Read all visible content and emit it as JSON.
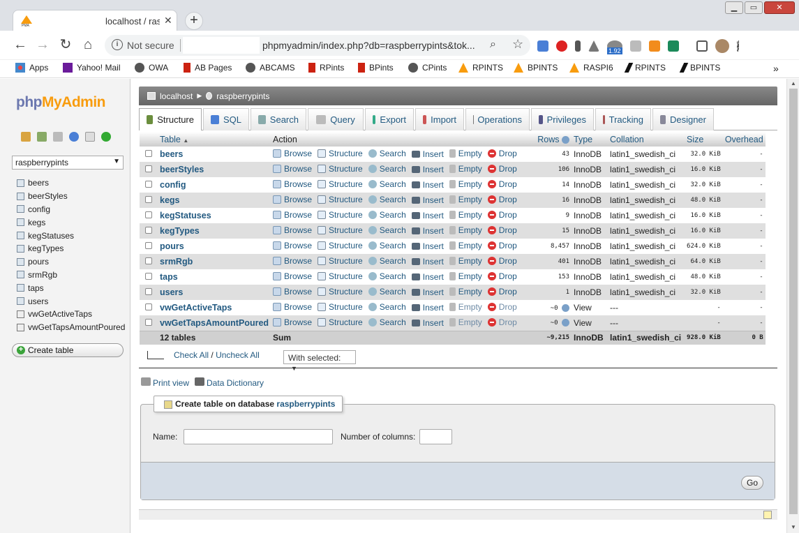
{
  "browser": {
    "tab_title": "localhost / ras",
    "tab_close": "✕",
    "new_tab": "+",
    "window_buttons": [
      "▁",
      "▭",
      "✕"
    ],
    "not_secure": "Not secure",
    "url": "phpmyadmin/index.php?db=raspberrypints&tok...",
    "extension_badge": "1.92",
    "bookmarks": [
      "Apps",
      "Yahoo! Mail",
      "OWA",
      "AB Pages",
      "ABCAMS",
      "RPints",
      "BPints",
      "CPints",
      "RPINTS",
      "BPINTS",
      "RASPI6",
      "RPINTS",
      "BPINTS"
    ],
    "bookmarks_more": "»"
  },
  "pma": {
    "logo_a": "php",
    "logo_b": "MyAdmin",
    "db_select": "raspberrypints",
    "sidebar_tables": [
      "beers",
      "beerStyles",
      "config",
      "kegs",
      "kegStatuses",
      "kegTypes",
      "pours",
      "srmRgb",
      "taps",
      "users",
      "vwGetActiveTaps",
      "vwGetTapsAmountPoured"
    ],
    "create_table_btn": "Create table",
    "breadcrumb": [
      "localhost",
      "raspberrypints"
    ],
    "tabs": [
      "Structure",
      "SQL",
      "Search",
      "Query",
      "Export",
      "Import",
      "Operations",
      "Privileges",
      "Tracking",
      "Designer"
    ],
    "headers": {
      "table": "Table",
      "action": "Action",
      "rows": "Rows",
      "type": "Type",
      "collation": "Collation",
      "size": "Size",
      "overhead": "Overhead"
    },
    "actions": [
      "Browse",
      "Structure",
      "Search",
      "Insert",
      "Empty",
      "Drop"
    ],
    "rows": [
      {
        "name": "beers",
        "rows": "43",
        "type": "InnoDB",
        "collation": "latin1_swedish_ci",
        "size": "32.0 KiB",
        "overhead": "-"
      },
      {
        "name": "beerStyles",
        "rows": "106",
        "type": "InnoDB",
        "collation": "latin1_swedish_ci",
        "size": "16.0 KiB",
        "overhead": "-"
      },
      {
        "name": "config",
        "rows": "14",
        "type": "InnoDB",
        "collation": "latin1_swedish_ci",
        "size": "32.0 KiB",
        "overhead": "-"
      },
      {
        "name": "kegs",
        "rows": "16",
        "type": "InnoDB",
        "collation": "latin1_swedish_ci",
        "size": "48.0 KiB",
        "overhead": "-"
      },
      {
        "name": "kegStatuses",
        "rows": "9",
        "type": "InnoDB",
        "collation": "latin1_swedish_ci",
        "size": "16.0 KiB",
        "overhead": "-"
      },
      {
        "name": "kegTypes",
        "rows": "15",
        "type": "InnoDB",
        "collation": "latin1_swedish_ci",
        "size": "16.0 KiB",
        "overhead": "-"
      },
      {
        "name": "pours",
        "rows": "8,457",
        "type": "InnoDB",
        "collation": "latin1_swedish_ci",
        "size": "624.0 KiB",
        "overhead": "-"
      },
      {
        "name": "srmRgb",
        "rows": "401",
        "type": "InnoDB",
        "collation": "latin1_swedish_ci",
        "size": "64.0 KiB",
        "overhead": "-"
      },
      {
        "name": "taps",
        "rows": "153",
        "type": "InnoDB",
        "collation": "latin1_swedish_ci",
        "size": "48.0 KiB",
        "overhead": "-"
      },
      {
        "name": "users",
        "rows": "1",
        "type": "InnoDB",
        "collation": "latin1_swedish_ci",
        "size": "32.0 KiB",
        "overhead": "-"
      },
      {
        "name": "vwGetActiveTaps",
        "rows": "~0",
        "type": "View",
        "collation": "---",
        "size": "-",
        "overhead": "-"
      },
      {
        "name": "vwGetTapsAmountPoured",
        "rows": "~0",
        "type": "View",
        "collation": "---",
        "size": "-",
        "overhead": "-"
      }
    ],
    "summary": {
      "count": "12 tables",
      "label": "Sum",
      "rows": "~9,215",
      "type": "InnoDB",
      "collation": "latin1_swedish_ci",
      "size": "928.0 KiB",
      "overhead": "0 B"
    },
    "check_all": "Check All",
    "uncheck_all": "Uncheck All",
    "check_sep": "/",
    "with_selected": "With selected:",
    "print_view": "Print view",
    "data_dictionary": "Data Dictionary",
    "create_legend": "Create table on database",
    "create_db": "raspberrypints",
    "name_label": "Name:",
    "cols_label": "Number of columns:",
    "go": "Go"
  }
}
